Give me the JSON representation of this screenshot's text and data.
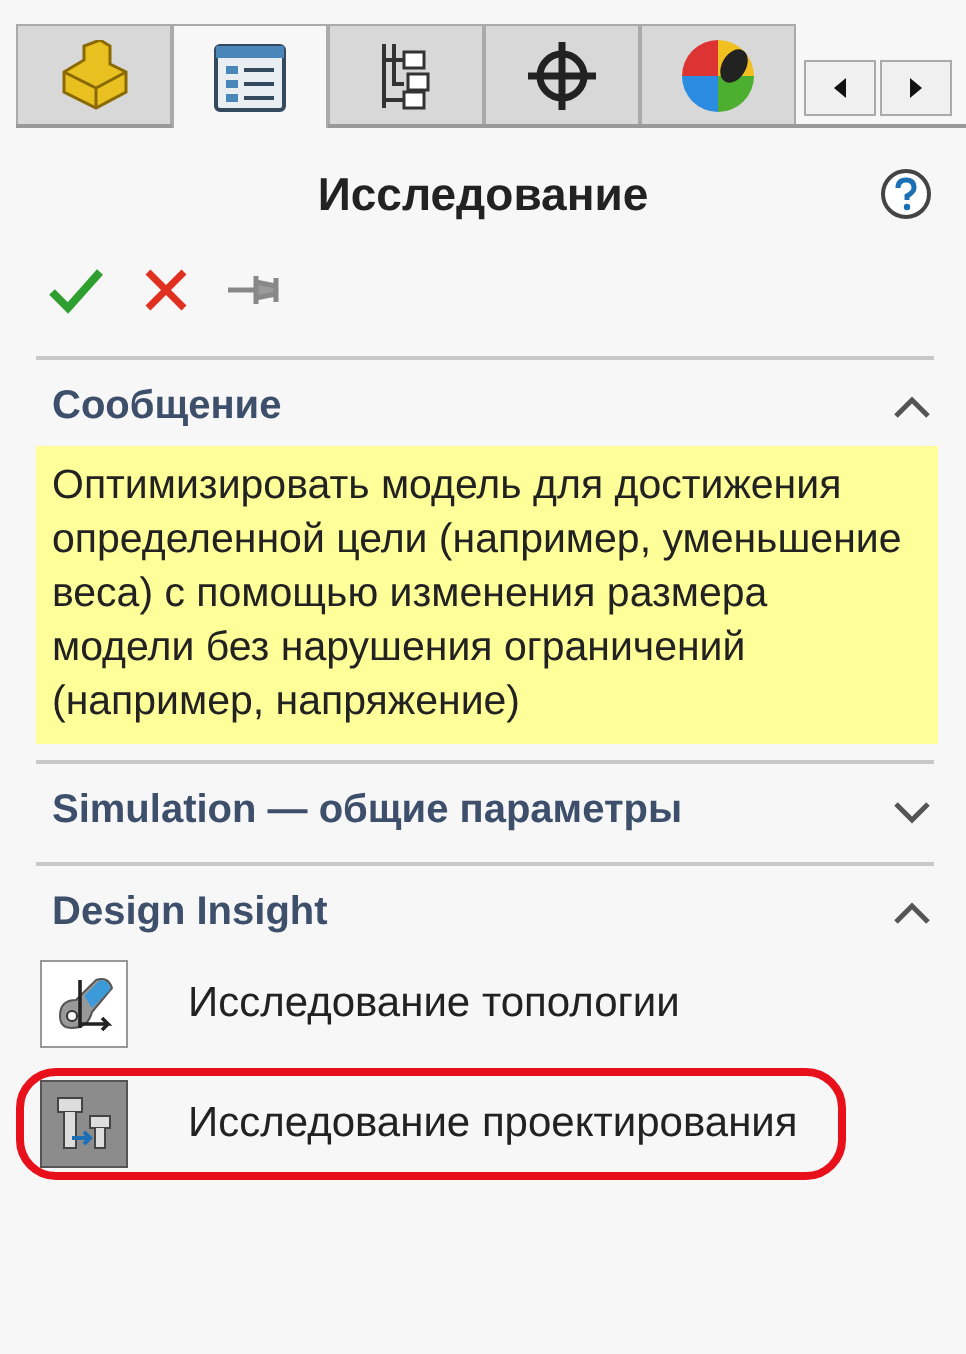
{
  "tabs": [
    {
      "selected": false
    },
    {
      "selected": true
    },
    {
      "selected": false
    },
    {
      "selected": false
    },
    {
      "selected": false
    }
  ],
  "title": "Исследование",
  "sections": [
    {
      "title": "Сообщение",
      "expanded": true,
      "kind": "message",
      "text": "Оптимизировать модель для достижения определенной цели (например, уменьшение веса) с помощью изменения размера модели без нарушения ограничений (например, напряжение)"
    },
    {
      "title": "Simulation — общие параметры",
      "expanded": false
    },
    {
      "title": "Design Insight",
      "expanded": true,
      "kind": "list",
      "items": [
        {
          "label": "Исследование топологии",
          "selected": false,
          "highlighted": false
        },
        {
          "label": "Исследование проектирования",
          "selected": true,
          "highlighted": true
        }
      ]
    }
  ]
}
